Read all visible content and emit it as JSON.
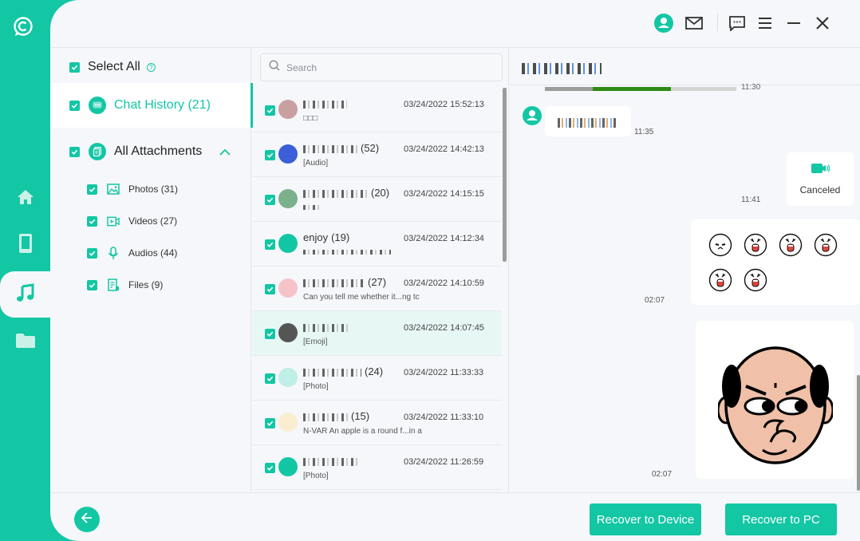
{
  "colors": {
    "accent": "#13c6a4",
    "background": "#f5f7fa",
    "voice_progress": "#2e8b13"
  },
  "rail": {
    "logo_icon": "recovery-logo-icon",
    "items": [
      {
        "icon": "home-icon",
        "active": false
      },
      {
        "icon": "device-icon",
        "active": false
      },
      {
        "icon": "music-icon",
        "active": true
      },
      {
        "icon": "folder-icon",
        "active": false
      }
    ]
  },
  "topbar": {
    "icons": [
      "account-icon",
      "mail-icon",
      "feedback-icon",
      "menu-icon",
      "minimize-icon",
      "close-icon"
    ]
  },
  "categories": {
    "select_all": "Select All",
    "help_icon": "?",
    "chat_history": "Chat History (21)",
    "all_attachments": "All Attachments",
    "sub_items": [
      {
        "label": "Photos (31)",
        "icon": "photo-icon"
      },
      {
        "label": "Videos (27)",
        "icon": "video-icon"
      },
      {
        "label": "Audios (44)",
        "icon": "microphone-icon"
      },
      {
        "label": "Files (9)",
        "icon": "file-icon"
      }
    ]
  },
  "search": {
    "placeholder": "Search",
    "value": ""
  },
  "chats": [
    {
      "name_masked": true,
      "count": "",
      "time": "03/24/2022 15:52:13",
      "preview": "□□□",
      "selected": false,
      "avatar_color": "#c9a0a0"
    },
    {
      "name_masked": true,
      "count": "(52)",
      "time": "03/24/2022 14:42:13",
      "preview": "[Audio]",
      "selected": false,
      "avatar_color": "#3a5fd8"
    },
    {
      "name_masked": true,
      "count": "(20)",
      "time": "03/24/2022 14:15:15",
      "preview": "",
      "selected": false,
      "avatar_color": "#7ab08a"
    },
    {
      "name": "enjoy",
      "count": "(19)",
      "time": "03/24/2022 14:12:34",
      "preview": "",
      "selected": false,
      "avatar_color": "#13c6a4"
    },
    {
      "name_masked": true,
      "count": "(27)",
      "time": "03/24/2022 14:10:59",
      "preview": "Can you tell me whether it...ng tc",
      "selected": false,
      "avatar_color": "#f4c4c8"
    },
    {
      "name_masked": true,
      "count": "",
      "time": "03/24/2022 14:07:45",
      "preview": "[Emoji]",
      "selected": true,
      "avatar_color": "#555555"
    },
    {
      "name_masked": true,
      "count": "(24)",
      "time": "03/24/2022 11:33:33",
      "preview": "[Photo]",
      "selected": false,
      "avatar_color": "#bfeee6"
    },
    {
      "name_masked": true,
      "count": "(15)",
      "time": "03/24/2022 11:33:10",
      "preview": "N-VAR An apple is a round f...in a",
      "selected": false,
      "avatar_color": "#fbeed0"
    },
    {
      "name_masked": true,
      "count": "",
      "time": "03/24/2022 11:26:59",
      "preview": "[Photo]",
      "selected": false,
      "avatar_color": "#13c6a4"
    }
  ],
  "conversation": {
    "voice_progress": {
      "played_fraction": 0.25,
      "progress_start": 0.25,
      "progress_end": 0.66
    },
    "voice_time": "11:30",
    "messages": [
      {
        "type": "text",
        "direction": "incoming",
        "time": "11:35"
      },
      {
        "type": "video-call",
        "direction": "outgoing",
        "label": "Canceled",
        "time": "11:41"
      },
      {
        "type": "emoji-set",
        "direction": "outgoing",
        "count": 6,
        "time": "02:07"
      },
      {
        "type": "sticker",
        "direction": "outgoing",
        "time": "02:07"
      }
    ]
  },
  "footer": {
    "back_icon": "back-arrow-icon",
    "recover_device": "Recover to Device",
    "recover_pc": "Recover to PC"
  }
}
